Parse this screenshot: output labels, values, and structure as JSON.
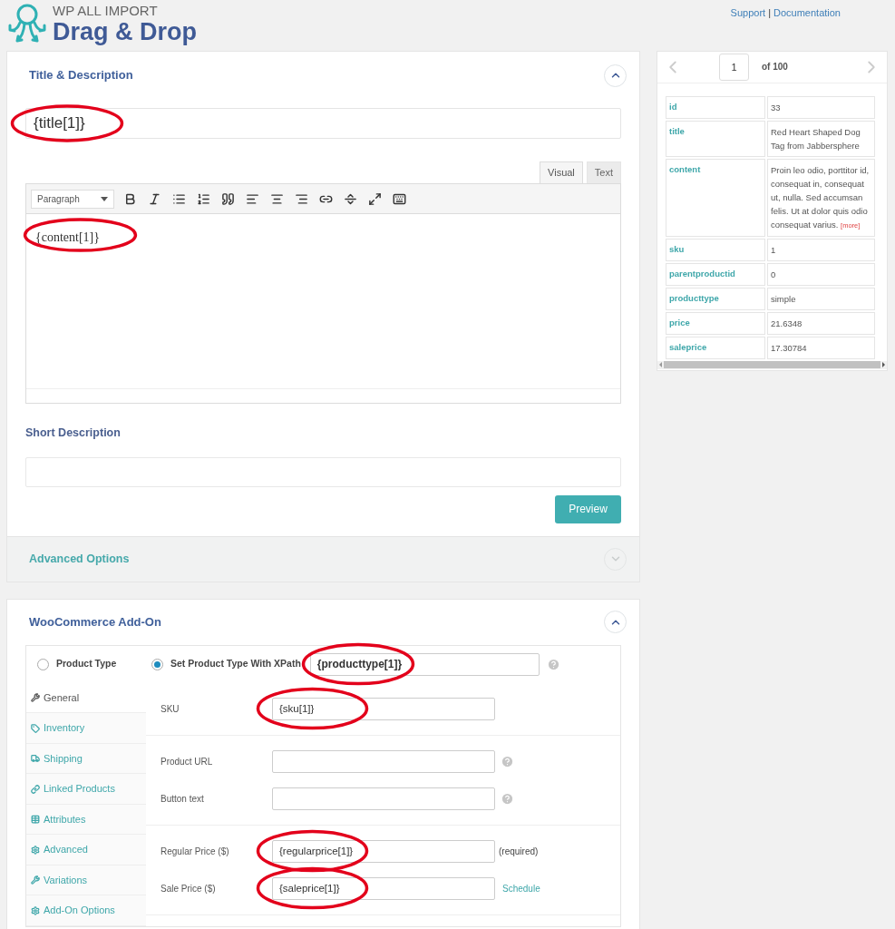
{
  "header": {
    "brand_top": "WP ALL IMPORT",
    "brand_title": "Drag & Drop",
    "links": [
      "Support",
      "Documentation"
    ],
    "separator": "|"
  },
  "title_panel": {
    "heading": "Title & Description",
    "expanded": true,
    "title_field": {
      "value": "{title[1]}",
      "circled": true
    },
    "editor_tabs": [
      {
        "label": "Visual",
        "selected": true
      },
      {
        "label": "Text",
        "selected": false
      }
    ],
    "format_select": "Paragraph",
    "content": {
      "value": "{content[1]}",
      "circled": true
    },
    "short_description_label": "Short Description",
    "preview_button": "Preview"
  },
  "advanced_panel": {
    "heading": "Advanced Options",
    "expanded": false
  },
  "woo_panel": {
    "heading": "WooCommerce Add-On",
    "expanded": true,
    "radios": [
      {
        "label": "Product Type",
        "selected": false
      },
      {
        "label": "Set Product Type With XPath",
        "selected": true
      }
    ],
    "xpath_field": {
      "value": "{producttype[1]}",
      "circled": true
    },
    "tabs": [
      {
        "label": "General",
        "selected": true
      },
      {
        "label": "Inventory",
        "selected": false
      },
      {
        "label": "Shipping",
        "selected": false
      },
      {
        "label": "Linked Products",
        "selected": false
      },
      {
        "label": "Attributes",
        "selected": false
      },
      {
        "label": "Advanced",
        "selected": false
      },
      {
        "label": "Variations",
        "selected": false
      },
      {
        "label": "Add-On Options",
        "selected": false
      }
    ],
    "groups": [
      [
        {
          "label": "SKU",
          "value": "{sku[1]}",
          "circled": true
        }
      ],
      [
        {
          "label": "Product URL",
          "circled": false,
          "after": {
            "kind": "help"
          }
        },
        {
          "label": "Button text",
          "circled": false,
          "after": {
            "kind": "help"
          }
        }
      ],
      [
        {
          "label": "Regular Price ($)",
          "value": "{regularprice[1]}",
          "circled": true,
          "after": {
            "kind": "note",
            "text": "(required)"
          }
        },
        {
          "label": "Sale Price ($)",
          "value": "{saleprice[1]}",
          "circled": true,
          "after": {
            "kind": "link",
            "text": "Schedule"
          }
        }
      ]
    ]
  },
  "record_viewer": {
    "page": "1",
    "of": "of 100",
    "rows": [
      {
        "key": "id",
        "value": "33"
      },
      {
        "key": "title",
        "value": "Red Heart Shaped Dog Tag from Jabbersphere"
      },
      {
        "key": "content",
        "value": "Proin leo odio, porttitor id, consequat in, consequat ut, nulla. Sed accumsan felis. Ut at dolor quis odio consequat varius.",
        "more": "[more]"
      },
      {
        "key": "sku",
        "value": "1"
      },
      {
        "key": "parentproductid",
        "value": "0"
      },
      {
        "key": "producttype",
        "value": "simple"
      },
      {
        "key": "price",
        "value": "21.6348"
      },
      {
        "key": "saleprice",
        "value": "17.30784"
      }
    ]
  }
}
